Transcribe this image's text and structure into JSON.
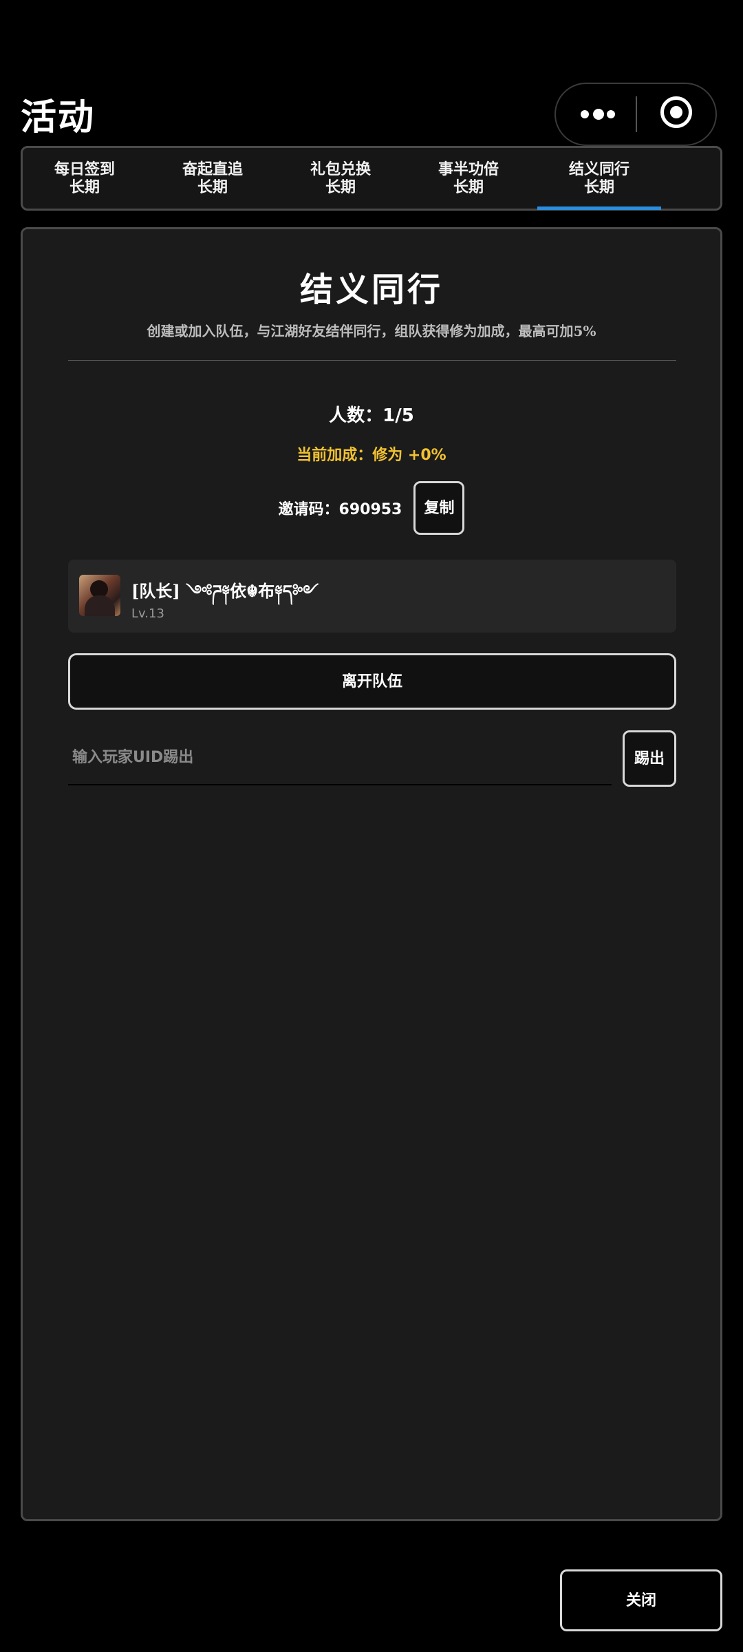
{
  "header": {
    "title": "活动"
  },
  "tabs": [
    {
      "label": "每日签到",
      "sub": "长期"
    },
    {
      "label": "奋起直追",
      "sub": "长期"
    },
    {
      "label": "礼包兑换",
      "sub": "长期"
    },
    {
      "label": "事半功倍",
      "sub": "长期"
    },
    {
      "label": "结义同行",
      "sub": "长期"
    }
  ],
  "activeTab": 4,
  "panel": {
    "title": "结义同行",
    "description": "创建或加入队伍，与江湖好友结伴同行，组队获得修为加成，最高可加5%",
    "member_count": "人数：1/5",
    "bonus": "当前加成：修为 +0%",
    "invite_text": "邀请码：690953",
    "copy_label": "复制",
    "member": {
      "name": "[队长] ༺ཌ༈依☬布༈ད༻",
      "level": "Lv.13"
    },
    "leave_label": "离开队伍",
    "kick_placeholder": "输入玩家UID踢出",
    "kick_value": "",
    "kick_label": "踢出"
  },
  "footer": {
    "close_label": "关闭"
  },
  "colors": {
    "background": "#000000",
    "panel": "#1b1b1b",
    "accent": "#2a8de0",
    "bonus": "#f2c230"
  },
  "icons": {
    "capsule_more": "more-dots-icon",
    "capsule_close": "target-circle-icon",
    "avatar": "avatar-image"
  }
}
